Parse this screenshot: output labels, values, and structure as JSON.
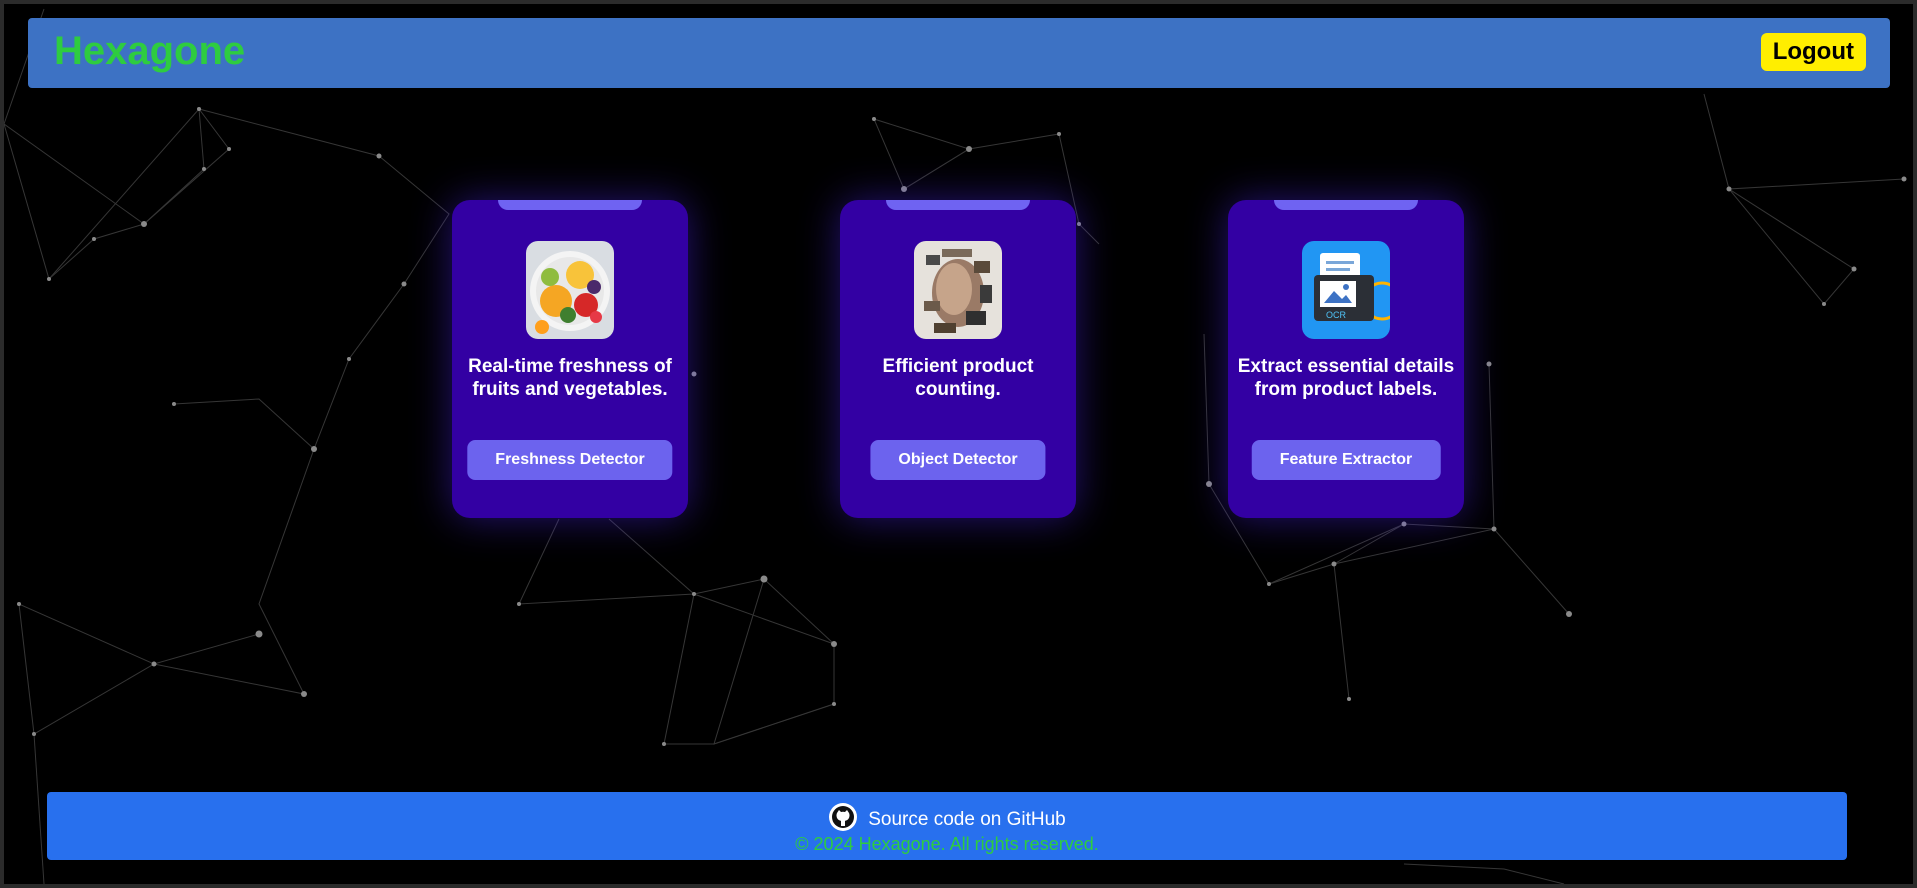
{
  "header": {
    "brand": "Hexagone",
    "logout_label": "Logout"
  },
  "cards": [
    {
      "image": "fruit-platter-image",
      "description": "Real-time freshness of fruits and vegetables.",
      "button_label": "Freshness Detector"
    },
    {
      "image": "fragmented-face-image",
      "description": "Efficient product counting.",
      "button_label": "Object Detector"
    },
    {
      "image": "ocr-document-image",
      "description": "Extract essential details from product labels.",
      "button_label": "Feature Extractor"
    }
  ],
  "ocr_badge_text": "OCR",
  "footer": {
    "github_icon": "github-icon",
    "github_label": "Source code on GitHub",
    "copyright": "© 2024 Hexagone. All rights reserved."
  },
  "colors": {
    "brand_green": "#2ecc40",
    "header_blue": "#3d72c4",
    "logout_yellow": "#ffee00",
    "card_purple": "#3300a3",
    "button_violet": "#6c63ee",
    "footer_blue": "#2870ee"
  }
}
